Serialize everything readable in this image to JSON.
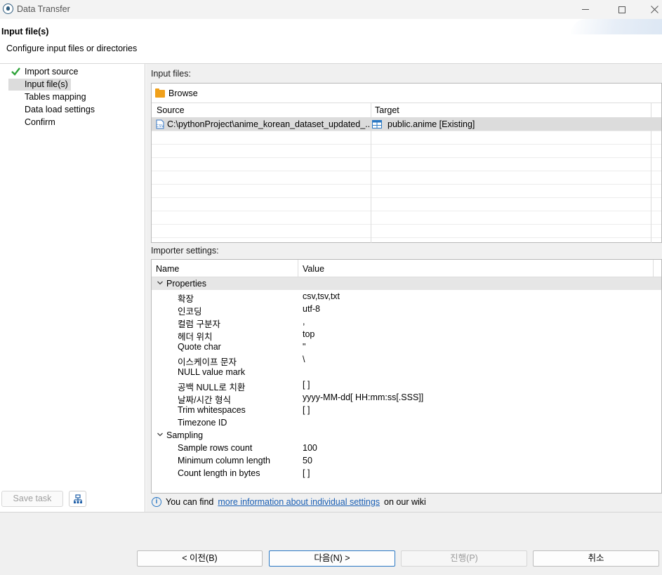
{
  "window": {
    "title": "Data Transfer"
  },
  "header": {
    "title": "Input file(s)",
    "description": "Configure input files or directories"
  },
  "nav": {
    "items": [
      {
        "label": "Import source",
        "state": "done"
      },
      {
        "label": "Input file(s)",
        "state": "selected"
      },
      {
        "label": "Tables mapping",
        "state": ""
      },
      {
        "label": "Data load settings",
        "state": ""
      },
      {
        "label": "Confirm",
        "state": ""
      }
    ],
    "save_task": "Save task"
  },
  "input_files": {
    "label": "Input files:",
    "browse": "Browse",
    "columns": {
      "source": "Source",
      "target": "Target"
    },
    "rows": [
      {
        "source": "C:\\pythonProject\\anime_korean_dataset_updated_...",
        "target": "public.anime [Existing]"
      }
    ]
  },
  "importer": {
    "label": "Importer settings:",
    "columns": {
      "name": "Name",
      "value": "Value"
    },
    "groups": [
      {
        "name": "Properties",
        "rows": [
          {
            "name": "확장",
            "value": "csv,tsv,txt"
          },
          {
            "name": "인코딩",
            "value": "utf-8"
          },
          {
            "name": "컬럼 구분자",
            "value": ","
          },
          {
            "name": "헤더 위치",
            "value": "top"
          },
          {
            "name": "Quote char",
            "value": "\""
          },
          {
            "name": "이스케이프 문자",
            "value": "\\"
          },
          {
            "name": "NULL value mark",
            "value": ""
          },
          {
            "name": "공백 NULL로 치환",
            "value": "[ ]"
          },
          {
            "name": "날짜/시간 형식",
            "value": "yyyy-MM-dd[ HH:mm:ss[.SSS]]"
          },
          {
            "name": "Trim whitespaces",
            "value": "[ ]"
          },
          {
            "name": "Timezone ID",
            "value": ""
          }
        ]
      },
      {
        "name": "Sampling",
        "rows": [
          {
            "name": "Sample rows count",
            "value": "100"
          },
          {
            "name": "Minimum column length",
            "value": "50"
          },
          {
            "name": "Count length in bytes",
            "value": "[ ]"
          }
        ]
      }
    ]
  },
  "info": {
    "prefix": "You can find",
    "link": "more information about individual settings",
    "suffix": "on our wiki"
  },
  "buttons": {
    "back": "< 이전(B)",
    "next": "다음(N) >",
    "proceed": "진행(P)",
    "cancel": "취소"
  }
}
